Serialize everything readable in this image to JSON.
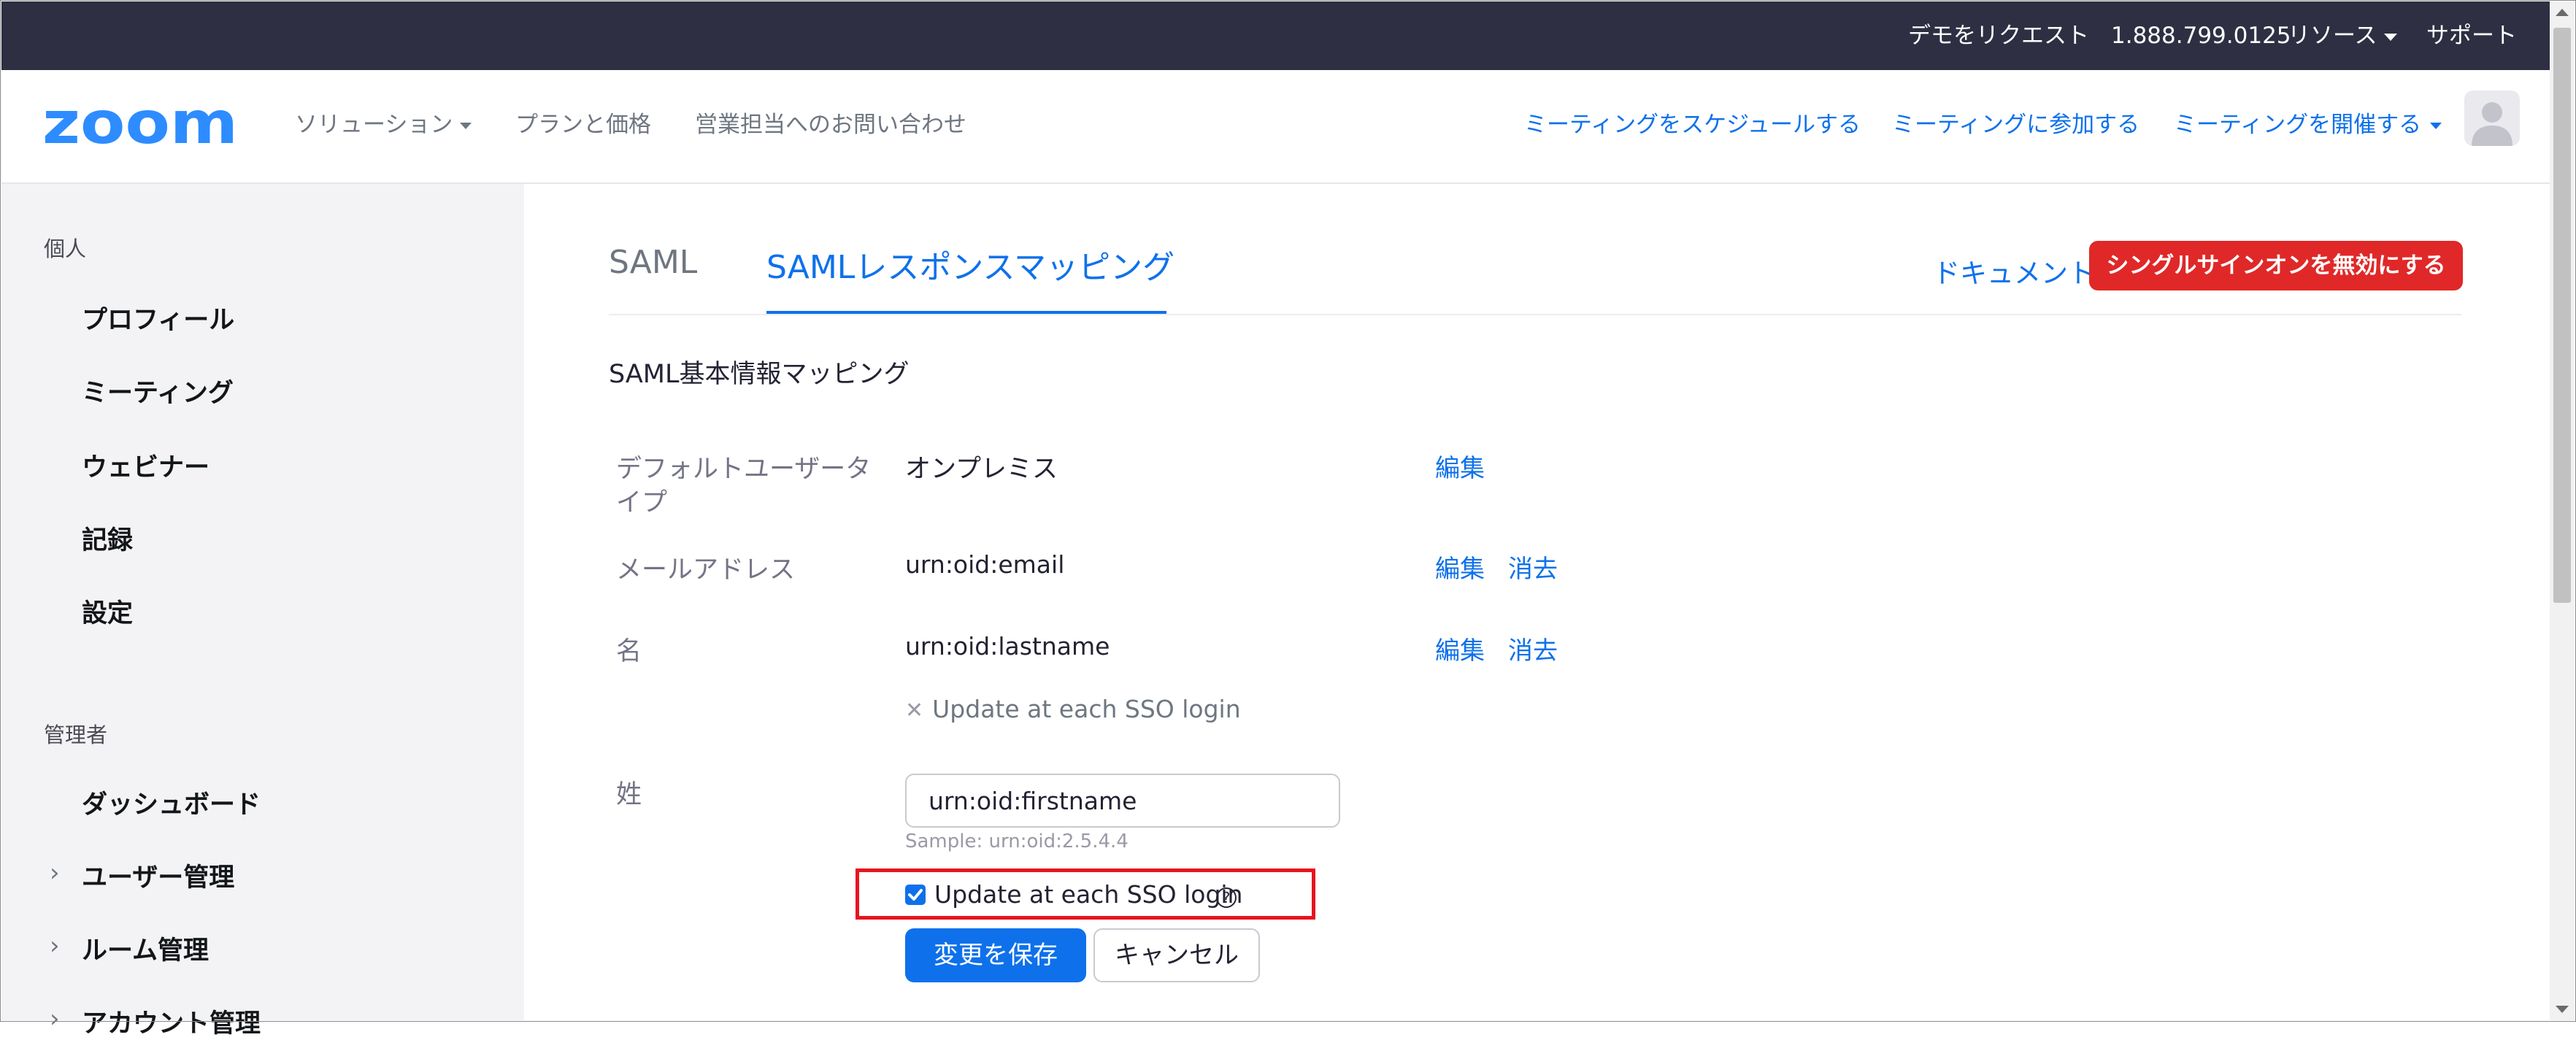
{
  "colors": {
    "brand_blue": "#0e71eb",
    "top_bar": "#2e2f42",
    "danger_red": "#e02828",
    "highlight_red": "#e8141e",
    "sidebar_bg": "#f3f3f5"
  },
  "topbar": {
    "request_demo": "デモをリクエスト",
    "phone": "1.888.799.0125",
    "resources": "リソース",
    "support": "サポート"
  },
  "header": {
    "logo_text": "zoom",
    "nav": {
      "solutions": "ソリューション",
      "plans_pricing": "プランと価格",
      "contact_sales": "営業担当へのお問い合わせ",
      "schedule_meeting": "ミーティングをスケジュールする",
      "join_meeting": "ミーティングに参加する",
      "host_meeting": "ミーティングを開催する"
    },
    "avatar_icon": "user-avatar-icon"
  },
  "sidebar": {
    "personal_heading": "個人",
    "personal_items": [
      "プロフィール",
      "ミーティング",
      "ウェビナー",
      "記録",
      "設定"
    ],
    "admin_heading": "管理者",
    "admin_items": [
      {
        "label": "ダッシュボード",
        "expandable": false
      },
      {
        "label": "ユーザー管理",
        "expandable": true
      },
      {
        "label": "ルーム管理",
        "expandable": true
      },
      {
        "label": "アカウント管理",
        "expandable": true
      }
    ]
  },
  "main": {
    "tabs": [
      {
        "label": "SAML",
        "active": false
      },
      {
        "label": "SAMLレスポンスマッピング",
        "active": true
      }
    ],
    "document_link": "ドキュメント",
    "disable_sso_button": "シングルサインオンを無効にする",
    "section_title": "SAML基本情報マッピング",
    "rows": {
      "default_user_type": {
        "label_line1": "デフォルトユーザータ",
        "label_line2": "イプ",
        "value": "オンプレミス",
        "edit": "編集"
      },
      "email": {
        "label": "メールアドレス",
        "value": "urn:oid:email",
        "edit": "編集",
        "delete": "消去"
      },
      "first_name": {
        "label": "名",
        "value": "urn:oid:lastname",
        "edit": "編集",
        "delete": "消去",
        "update_note": "Update at each SSO login"
      },
      "last_name": {
        "label": "姓",
        "input_value": "urn:oid:firstname",
        "sample": "Sample: urn:oid:2.5.4.4",
        "checkbox_label": "Update at each SSO login",
        "checkbox_checked": true,
        "help_icon": "question-circle-icon"
      }
    },
    "save_button": "変更を保存",
    "cancel_button": "キャンセル"
  }
}
